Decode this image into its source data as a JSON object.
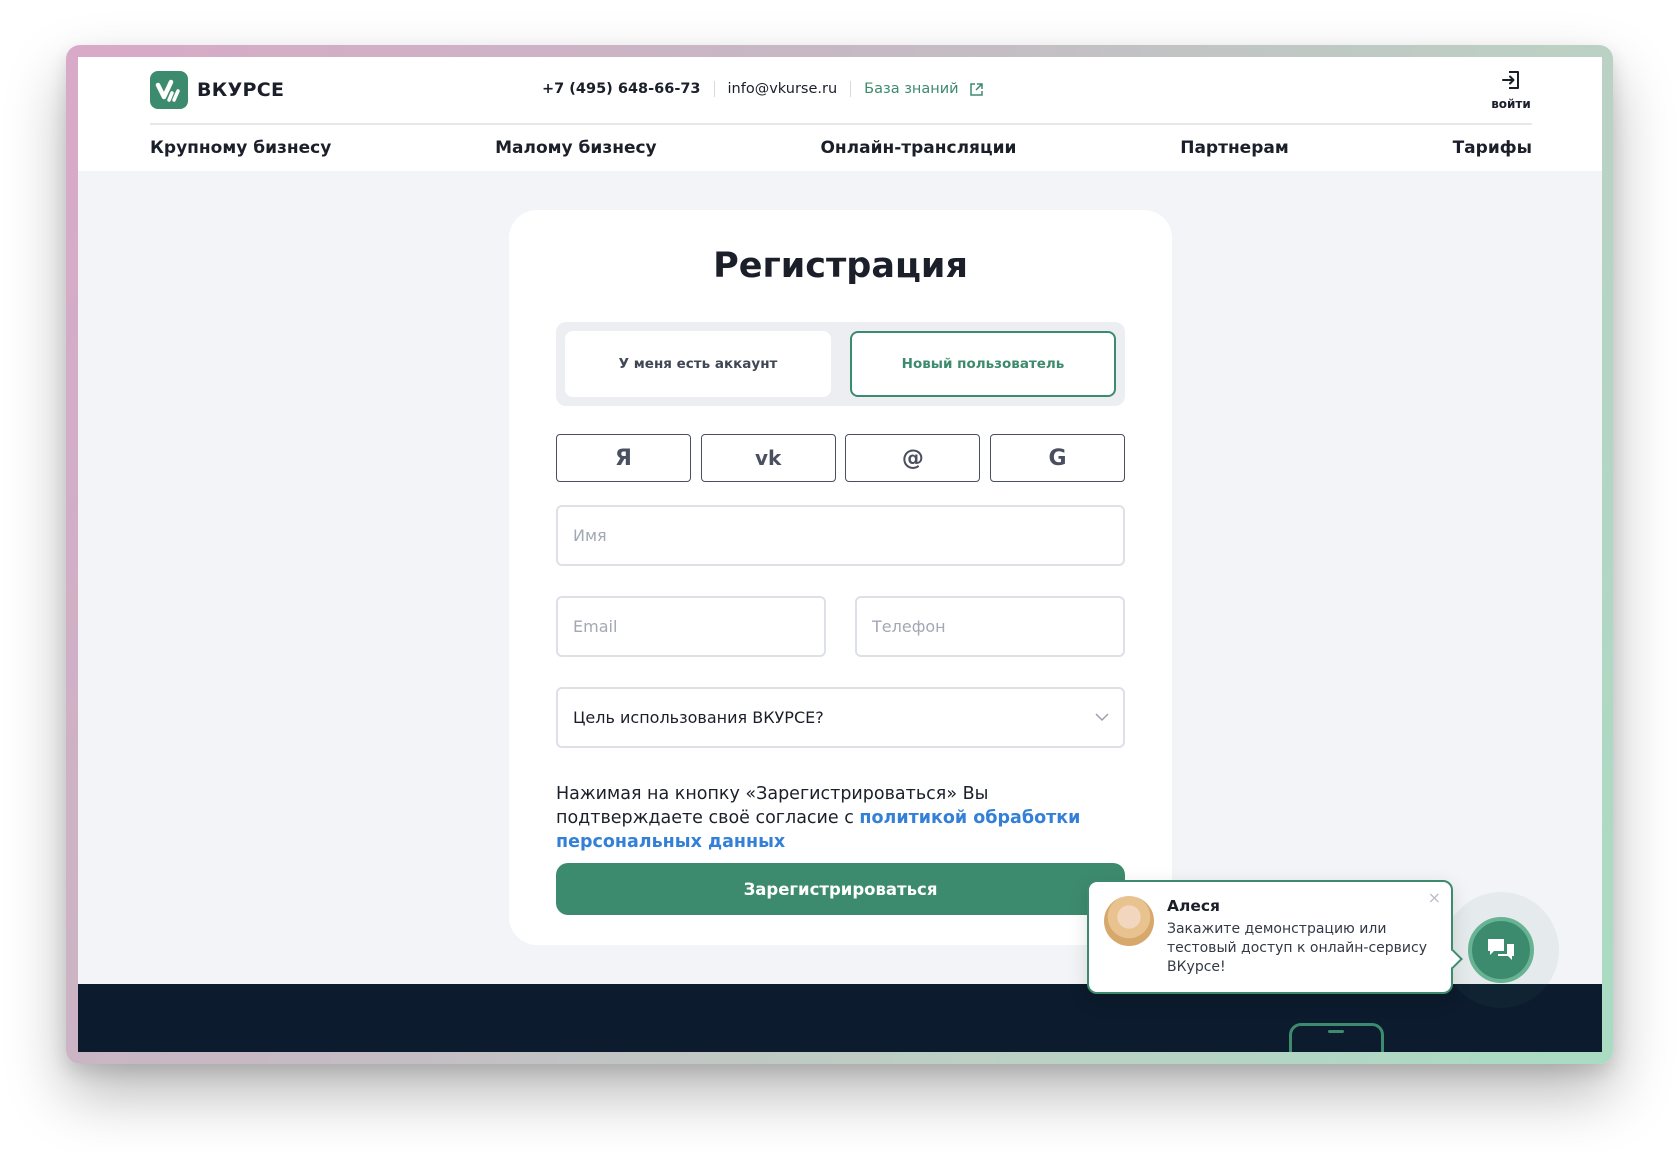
{
  "brand": {
    "name": "ВКУРСЕ",
    "color": "#3d8b6e"
  },
  "header": {
    "phone": "+7 (495) 648-66-73",
    "email": "info@vkurse.ru",
    "knowledge_base": "База знаний",
    "login_label": "войти"
  },
  "nav": [
    {
      "label": "Крупному бизнесу"
    },
    {
      "label": "Малому бизнесу"
    },
    {
      "label": "Онлайн-трансляции"
    },
    {
      "label": "Партнерам"
    },
    {
      "label": "Тарифы"
    }
  ],
  "form": {
    "title": "Регистрация",
    "toggle": {
      "existing": "У меня есть аккаунт",
      "new": "Новый пользователь"
    },
    "social": [
      {
        "label": "Я",
        "icon": "yandex-icon"
      },
      {
        "label": "vk",
        "icon": "vk-icon"
      },
      {
        "label": "@",
        "icon": "mail-icon"
      },
      {
        "label": "G",
        "icon": "google-icon"
      }
    ],
    "name_placeholder": "Имя",
    "email_placeholder": "Email",
    "phone_placeholder": "Телефон",
    "purpose_select": "Цель использования ВКУРСЕ?",
    "consent_text": "Нажимая на кнопку «Зарегистрироваться» Вы подтверждаете своё согласие с ",
    "consent_link": "политикой обработки персональных данных",
    "submit": "Зарегистрироваться"
  },
  "chat": {
    "name": "Алеся",
    "message": "Закажите демонстрацию или тестовый доступ к онлайн-сервису ВКурсе!",
    "close": "×"
  }
}
